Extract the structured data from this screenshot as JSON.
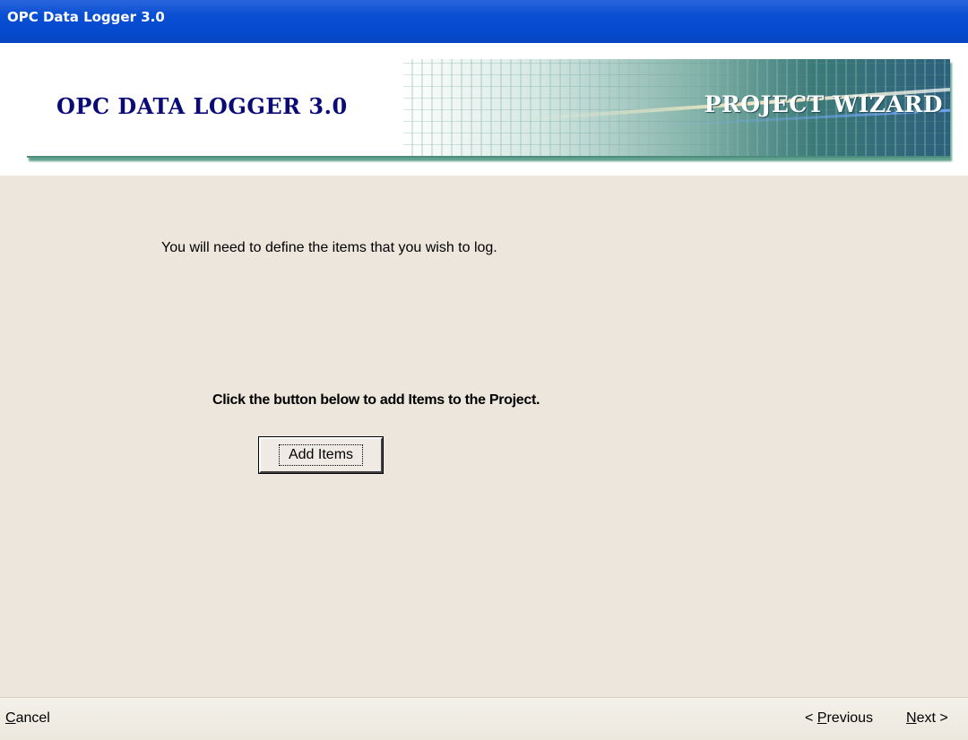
{
  "window": {
    "title": "OPC Data Logger 3.0"
  },
  "banner": {
    "product": "OPC DATA LOGGER 3.0",
    "section": "PROJECT WIZARD"
  },
  "content": {
    "intro": "You will need to define the items that you wish to log.",
    "instruction": "Click the button below to add Items to the Project.",
    "add_items_label": "Add Items"
  },
  "footer": {
    "cancel": {
      "mnemonic": "C",
      "rest": "ancel"
    },
    "previous": {
      "prefix": "< ",
      "mnemonic": "P",
      "rest": "revious"
    },
    "next": {
      "mnemonic": "N",
      "rest": "ext >"
    }
  },
  "colors": {
    "titlebar": "#0a4fd3",
    "content_bg": "#ede6dd",
    "logo_text": "#0b0b78"
  }
}
